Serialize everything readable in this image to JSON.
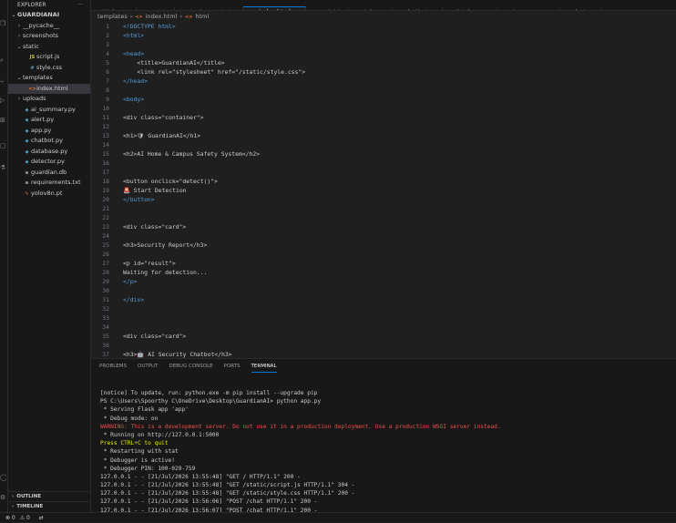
{
  "sidebar": {
    "title": "EXPLORER",
    "more": "···",
    "items": [
      {
        "chev": "⌄",
        "icon": "",
        "label": "GUARDIANAI",
        "indent": 0,
        "bold": true
      },
      {
        "chev": "›",
        "icon": "",
        "label": "__pycache__",
        "indent": 1
      },
      {
        "chev": "›",
        "icon": "",
        "label": "screenshots",
        "indent": 1
      },
      {
        "chev": "⌄",
        "icon": "",
        "label": "static",
        "indent": 1
      },
      {
        "chev": "",
        "icon": "JS",
        "label": "script.js",
        "indent": 2,
        "color": "#cbcb41"
      },
      {
        "chev": "",
        "icon": "#",
        "label": "style.css",
        "indent": 2,
        "color": "#519aba"
      },
      {
        "chev": "⌄",
        "icon": "",
        "label": "templates",
        "indent": 1
      },
      {
        "chev": "",
        "icon": "<>",
        "label": "index.html",
        "indent": 2,
        "color": "#e37933",
        "selected": true
      },
      {
        "chev": "›",
        "icon": "",
        "label": "uploads",
        "indent": 1
      },
      {
        "chev": "",
        "icon": "◆",
        "label": "ai_summary.py",
        "indent": 1,
        "color": "#519aba"
      },
      {
        "chev": "",
        "icon": "◆",
        "label": "alert.py",
        "indent": 1,
        "color": "#519aba"
      },
      {
        "chev": "",
        "icon": "◆",
        "label": "app.py",
        "indent": 1,
        "color": "#519aba"
      },
      {
        "chev": "",
        "icon": "◆",
        "label": "chatbot.py",
        "indent": 1,
        "color": "#519aba"
      },
      {
        "chev": "",
        "icon": "◆",
        "label": "database.py",
        "indent": 1,
        "color": "#519aba"
      },
      {
        "chev": "",
        "icon": "◆",
        "label": "detector.py",
        "indent": 1,
        "color": "#519aba"
      },
      {
        "chev": "",
        "icon": "≡",
        "label": "guardian.db",
        "indent": 1,
        "color": "#cccccc"
      },
      {
        "chev": "",
        "icon": "≡",
        "label": "requirements.txt",
        "indent": 1,
        "color": "#cccccc"
      },
      {
        "chev": "",
        "icon": "✎",
        "label": "yolov8n.pt",
        "indent": 1,
        "color": "#e37933"
      }
    ],
    "outline": "OUTLINE",
    "timeline": "TIMELINE"
  },
  "tabs": [
    {
      "icon": "≺",
      "label": "Welcome",
      "color": "#3b8eea"
    },
    {
      "icon": "◆",
      "label": "app.py",
      "color": "#519aba"
    },
    {
      "icon": "≡",
      "label": "requirements.txt",
      "color": "#cccccc"
    },
    {
      "icon": "<>",
      "label": "index.html",
      "color": "#e37933",
      "active": true,
      "close": "×"
    },
    {
      "icon": "JS",
      "label": "script.js",
      "color": "#cbcb41"
    },
    {
      "icon": "#",
      "label": "style.css",
      "color": "#519aba"
    },
    {
      "icon": "◆",
      "label": "chatbot.py",
      "color": "#519aba"
    },
    {
      "icon": "◆",
      "label": "database.py",
      "color": "#519aba"
    },
    {
      "icon": "◆",
      "label": "ai_summary.py",
      "color": "#519aba"
    },
    {
      "icon": "◆",
      "label": "alert.py",
      "color": "#519aba"
    }
  ],
  "breadcrumb": {
    "parts": [
      "templates",
      "›",
      "<>",
      "index.html",
      "›",
      "<>",
      "html"
    ]
  },
  "editor": {
    "lines": [
      {
        "n": "1",
        "t": "<!DOCTYPE html>",
        "c": "tag"
      },
      {
        "n": "2",
        "t": "<html>",
        "c": "tag"
      },
      {
        "n": "3",
        "t": ""
      },
      {
        "n": "4",
        "t": "<head>",
        "c": "tag"
      },
      {
        "n": "5",
        "t": "    <title>GuardianAI</title>"
      },
      {
        "n": "6",
        "t": "    <link rel=\"stylesheet\" href=\"/static/style.css\">"
      },
      {
        "n": "7",
        "t": "</head>",
        "c": "tag"
      },
      {
        "n": "8",
        "t": ""
      },
      {
        "n": "9",
        "t": "<body>",
        "c": "tag"
      },
      {
        "n": "10",
        "t": ""
      },
      {
        "n": "11",
        "t": "<div class=\"container\">"
      },
      {
        "n": "12",
        "t": ""
      },
      {
        "n": "13",
        "t": "<h1>🛡 GuardianAI</h1>"
      },
      {
        "n": "14",
        "t": ""
      },
      {
        "n": "15",
        "t": "<h2>AI Home & Campus Safety System</h2>"
      },
      {
        "n": "16",
        "t": ""
      },
      {
        "n": "17",
        "t": ""
      },
      {
        "n": "18",
        "t": "<button onclick=\"detect()\">"
      },
      {
        "n": "19",
        "t": "🚨 Start Detection"
      },
      {
        "n": "20",
        "t": "</button>",
        "c": "tag"
      },
      {
        "n": "21",
        "t": ""
      },
      {
        "n": "22",
        "t": ""
      },
      {
        "n": "23",
        "t": "<div class=\"card\">"
      },
      {
        "n": "24",
        "t": ""
      },
      {
        "n": "25",
        "t": "<h3>Security Report</h3>"
      },
      {
        "n": "26",
        "t": ""
      },
      {
        "n": "27",
        "t": "<p id=\"result\">"
      },
      {
        "n": "28",
        "t": "Waiting for detection..."
      },
      {
        "n": "29",
        "t": "</p>",
        "c": "tag"
      },
      {
        "n": "30",
        "t": ""
      },
      {
        "n": "31",
        "t": "</div>",
        "c": "tag"
      },
      {
        "n": "32",
        "t": ""
      },
      {
        "n": "33",
        "t": ""
      },
      {
        "n": "34",
        "t": ""
      },
      {
        "n": "35",
        "t": "<div class=\"card\">"
      },
      {
        "n": "36",
        "t": ""
      },
      {
        "n": "37",
        "t": "<h3>🤖 AI Security Chatbot</h3>"
      }
    ]
  },
  "panel": {
    "tabs": [
      {
        "label": "PROBLEMS"
      },
      {
        "label": "OUTPUT"
      },
      {
        "label": "DEBUG CONSOLE"
      },
      {
        "label": "PORTS"
      },
      {
        "label": "TERMINAL",
        "active": true
      }
    ],
    "terminal": [
      {
        "t": "[notice] To update, run: python.exe -m pip install --upgrade pip",
        "color": "#cccccc"
      },
      {
        "t": "PS C:\\Users\\Spoorthy C\\OneDrive\\Desktop\\GuardianAI> python app.py",
        "color": "#cccccc"
      },
      {
        "t": " * Serving Flask app 'app'",
        "color": "#cccccc"
      },
      {
        "t": " * Debug mode: on",
        "color": "#cccccc"
      },
      {
        "t": "WARNING: This is a development server. Do not use it in a production deployment. Use a production WSGI server instead.",
        "color": "#f14c4c"
      },
      {
        "t": " * Running on http://127.0.0.1:5000",
        "color": "#cccccc"
      },
      {
        "t": "Press CTRL+C to quit",
        "color": "#e5e510"
      },
      {
        "t": " * Restarting with stat",
        "color": "#cccccc"
      },
      {
        "t": " * Debugger is active!",
        "color": "#cccccc"
      },
      {
        "t": " * Debugger PIN: 100-029-759",
        "color": "#cccccc"
      },
      {
        "t": "127.0.0.1 - - [21/Jul/2026 13:55:48] \"GET / HTTP/1.1\" 200 -",
        "color": "#cccccc"
      },
      {
        "t": "127.0.0.1 - - [21/Jul/2026 13:55:48] \"GET /static/script.js HTTP/1.1\" 304 -",
        "color": "#cccccc"
      },
      {
        "t": "127.0.0.1 - - [21/Jul/2026 13:55:48] \"GET /static/style.css HTTP/1.1\" 200 -",
        "color": "#cccccc"
      },
      {
        "t": "127.0.0.1 - - [21/Jul/2026 13:56:06] \"POST /chat HTTP/1.1\" 200 -",
        "color": "#cccccc"
      },
      {
        "t": "127.0.0.1 - - [21/Jul/2026 13:56:07] \"POST /chat HTTP/1.1\" 200 -",
        "color": "#cccccc"
      }
    ]
  },
  "statusbar": {
    "errors": "⊗ 0",
    "warnings": "⚠ 0",
    "ports": "⇄"
  }
}
